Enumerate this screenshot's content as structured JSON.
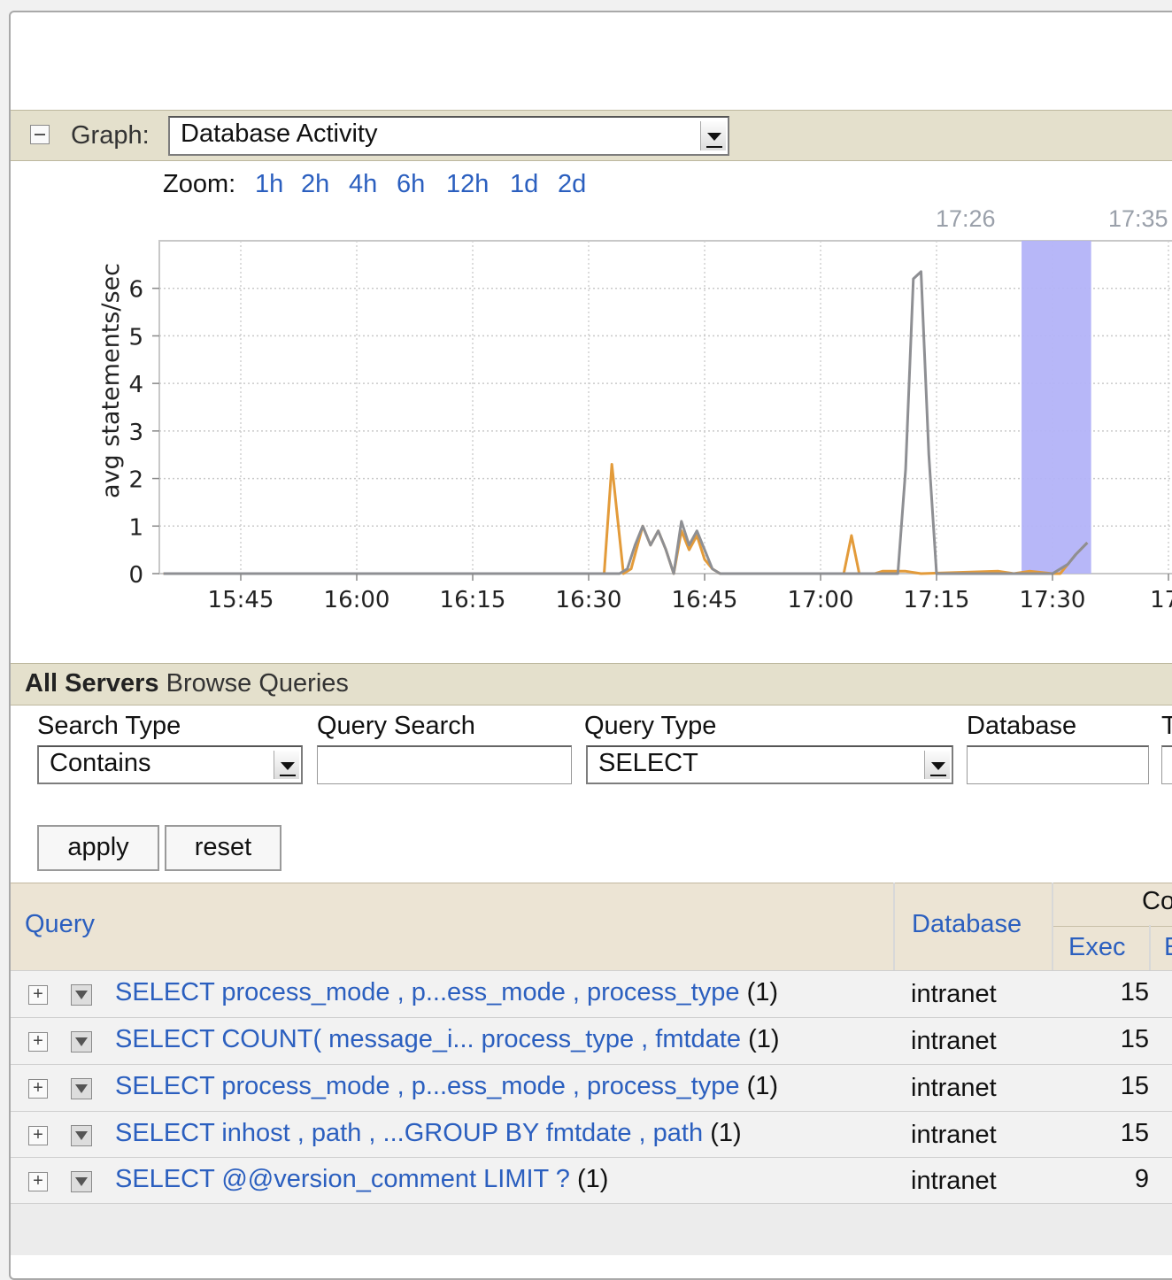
{
  "graph": {
    "label": "Graph:",
    "selected": "Database Activity",
    "zoom_label": "Zoom:",
    "zoom_options": [
      "1h",
      "2h",
      "4h",
      "6h",
      "12h",
      "1d",
      "2d"
    ],
    "top_time_labels": [
      "17:26",
      "17:35"
    ]
  },
  "chart_data": {
    "type": "line",
    "ylabel": "avg statements/sec",
    "xlabel": "",
    "ylim": [
      0,
      7
    ],
    "yticks": [
      0,
      1,
      2,
      3,
      4,
      5,
      6
    ],
    "xticks": [
      "15:45",
      "16:00",
      "16:15",
      "16:30",
      "16:45",
      "17:00",
      "17:15",
      "17:30",
      "17:"
    ],
    "x_unit": "minutes since 15:35",
    "highlight_range": [
      "17:26",
      "17:35"
    ],
    "highlight_color": "#b3b3f8",
    "series": [
      {
        "color": "#e39b3a",
        "points": [
          [
            0,
            0
          ],
          [
            55,
            0
          ],
          [
            57,
            0
          ],
          [
            58,
            2.3
          ],
          [
            59.5,
            0
          ],
          [
            60.5,
            0.1
          ],
          [
            62,
            1.0
          ],
          [
            63,
            0.6
          ],
          [
            64,
            0.9
          ],
          [
            65,
            0.5
          ],
          [
            66,
            0
          ],
          [
            67,
            0.9
          ],
          [
            68,
            0.5
          ],
          [
            69,
            0.8
          ],
          [
            70,
            0.3
          ],
          [
            71,
            0.1
          ],
          [
            72,
            0
          ],
          [
            74,
            0
          ],
          [
            86,
            0
          ],
          [
            88,
            0
          ],
          [
            89,
            0.8
          ],
          [
            90,
            0
          ],
          [
            91,
            0
          ],
          [
            92,
            0
          ],
          [
            93,
            0.05
          ],
          [
            96,
            0.05
          ],
          [
            98,
            0
          ],
          [
            108,
            0.05
          ],
          [
            110,
            0
          ],
          [
            112,
            0.05
          ],
          [
            115,
            0
          ],
          [
            116,
            0
          ],
          [
            118,
            0.4
          ],
          [
            119.5,
            0.65
          ],
          [
            119.5,
            0.65
          ]
        ]
      },
      {
        "color": "#8e8f93",
        "points": [
          [
            0,
            0
          ],
          [
            57,
            0
          ],
          [
            58,
            0
          ],
          [
            59,
            0
          ],
          [
            60,
            0.1
          ],
          [
            61,
            0.6
          ],
          [
            62,
            1.0
          ],
          [
            63,
            0.6
          ],
          [
            64,
            0.9
          ],
          [
            65,
            0.5
          ],
          [
            66,
            0
          ],
          [
            67,
            1.1
          ],
          [
            68,
            0.6
          ],
          [
            69,
            0.9
          ],
          [
            70,
            0.5
          ],
          [
            71,
            0.1
          ],
          [
            72,
            0
          ],
          [
            95,
            0
          ],
          [
            96,
            2.2
          ],
          [
            97,
            6.2
          ],
          [
            98,
            6.35
          ],
          [
            99,
            2.5
          ],
          [
            100,
            0
          ],
          [
            115,
            0
          ],
          [
            117,
            0.2
          ],
          [
            118,
            0.4
          ],
          [
            119.5,
            0.65
          ]
        ]
      }
    ]
  },
  "browse": {
    "title_bold": "All Servers",
    "title_rest": "Browse Queries",
    "search_type_label": "Search Type",
    "search_type_value": "Contains",
    "query_search_label": "Query Search",
    "query_type_label": "Query Type",
    "query_type_value": "SELECT",
    "database_label": "Database",
    "cut_label": "T",
    "apply_label": "apply",
    "reset_label": "reset"
  },
  "table": {
    "col_query": "Query",
    "col_database": "Database",
    "col_group": "Co",
    "col_exec": "Exec",
    "col_cut": "E",
    "rows": [
      {
        "query": "SELECT process_mode , p...ess_mode , process_type",
        "count": "(1)",
        "database": "intranet",
        "exec": "15"
      },
      {
        "query": "SELECT COUNT( message_i... process_type , fmtdate",
        "count": "(1)",
        "database": "intranet",
        "exec": "15"
      },
      {
        "query": "SELECT process_mode , p...ess_mode , process_type",
        "count": "(1)",
        "database": "intranet",
        "exec": "15"
      },
      {
        "query": "SELECT inhost , path , ...GROUP BY fmtdate , path",
        "count": "(1)",
        "database": "intranet",
        "exec": "15"
      },
      {
        "query": "SELECT @@version_comment LIMIT ?",
        "count": "(1)",
        "database": "intranet",
        "exec": "9"
      }
    ]
  }
}
